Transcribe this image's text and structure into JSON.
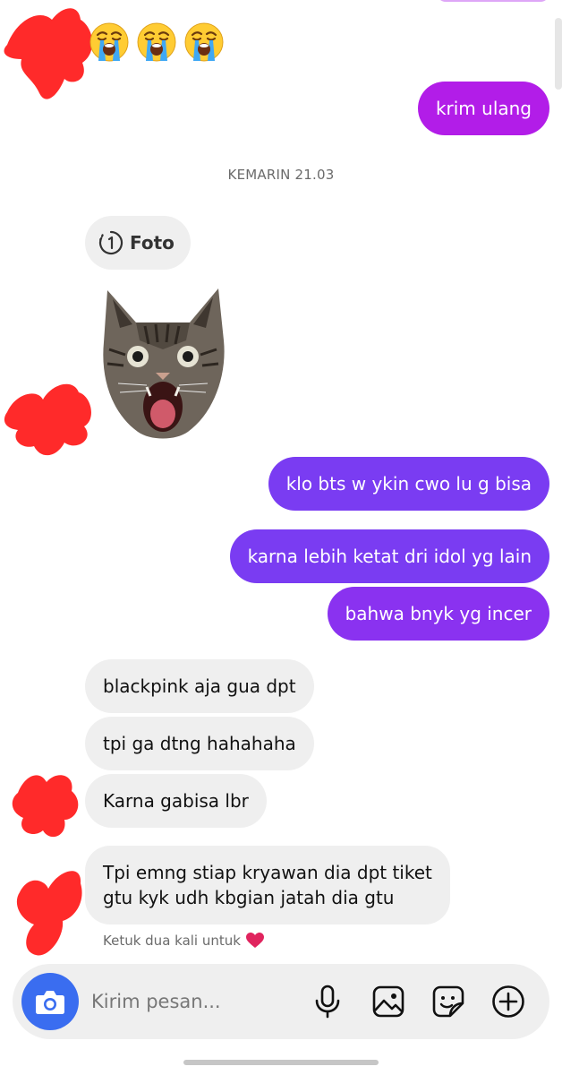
{
  "colors": {
    "sent_magenta": "#b21de8",
    "sent_purple": "#7a3cf2",
    "sent_violet": "#8a32f0",
    "received_bubble": "#efefef",
    "camera_button": "#3a6df0",
    "redaction_scribble": "#ff2a2a",
    "heart": "#e0245e"
  },
  "top_emojis": [
    "loudly-crying-face",
    "loudly-crying-face",
    "loudly-crying-face"
  ],
  "messages": {
    "krim_ulang": "krim ulang",
    "timestamp": "KEMARIN 21.03",
    "foto_label": "Foto",
    "foto_icon": "view-once-1-icon",
    "sticker": "screaming-cat-sticker",
    "sent_1": "klo bts w ykin cwo lu g bisa",
    "sent_2": "karna lebih ketat dri idol yg lain",
    "sent_3": "bahwa bnyk yg incer",
    "recv_1": "blackpink aja gua dpt",
    "recv_2": "tpi ga dtng hahahaha",
    "recv_3": "Karna gabisa lbr",
    "recv_4_line1": "Tpi emng stiap kryawan dia dpt tiket",
    "recv_4_line2": "gtu kyk udh kbgian jatah dia gtu"
  },
  "hint": {
    "text": "Ketuk dua kali untuk",
    "icon": "heart-icon"
  },
  "composer": {
    "placeholder": "Kirim pesan...",
    "camera_icon": "camera-icon",
    "mic_icon": "microphone-icon",
    "gallery_icon": "gallery-icon",
    "sticker_icon": "sticker-icon",
    "plus_icon": "plus-circle-icon"
  }
}
